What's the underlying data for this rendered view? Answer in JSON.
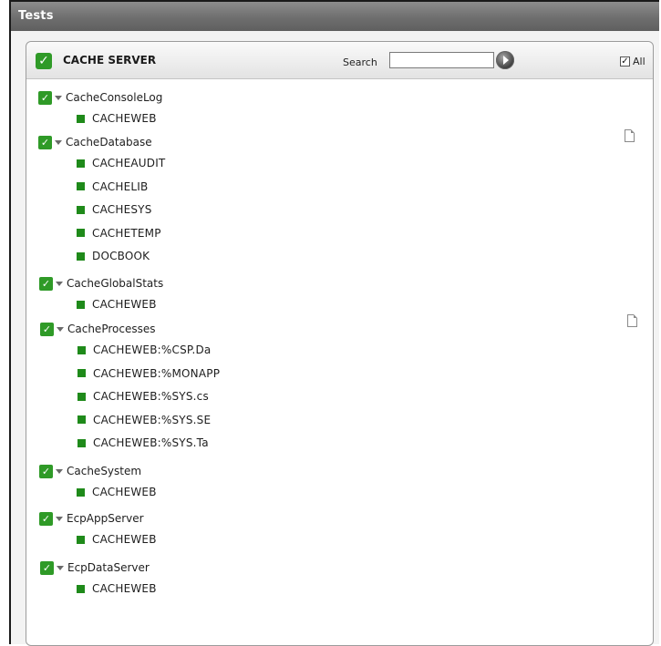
{
  "window": {
    "title": "Tests"
  },
  "panel": {
    "title": "CACHE SERVER",
    "search_label": "Search",
    "search_value": "",
    "all_label": "All",
    "all_checked": true
  },
  "groups": [
    {
      "name": "CacheConsoleLog",
      "items": [
        "CACHEWEB"
      ]
    },
    {
      "name": "CacheDatabase",
      "items": [
        "CACHEAUDIT",
        "CACHELIB",
        "CACHESYS",
        "CACHETEMP",
        "DOCBOOK"
      ]
    },
    {
      "name": "CacheGlobalStats",
      "items": [
        "CACHEWEB"
      ]
    },
    {
      "name": "CacheProcesses",
      "items": [
        "CACHEWEB:%CSP.Da",
        "CACHEWEB:%MONAPP",
        "CACHEWEB:%SYS.cs",
        "CACHEWEB:%SYS.SE",
        "CACHEWEB:%SYS.Ta"
      ]
    },
    {
      "name": "CacheSystem",
      "items": [
        "CACHEWEB"
      ]
    },
    {
      "name": "EcpAppServer",
      "items": [
        "CACHEWEB"
      ]
    },
    {
      "name": "EcpDataServer",
      "items": [
        "CACHEWEB"
      ]
    }
  ],
  "icons": {
    "group_checkbox": "checkbox-checked-icon",
    "expand": "expand-caret-icon",
    "item": "green-square-icon",
    "doc": "document-icon",
    "go": "search-go-icon"
  },
  "colors": {
    "accent_green": "#2f9a27",
    "titlebar": "#6e6e6e"
  }
}
